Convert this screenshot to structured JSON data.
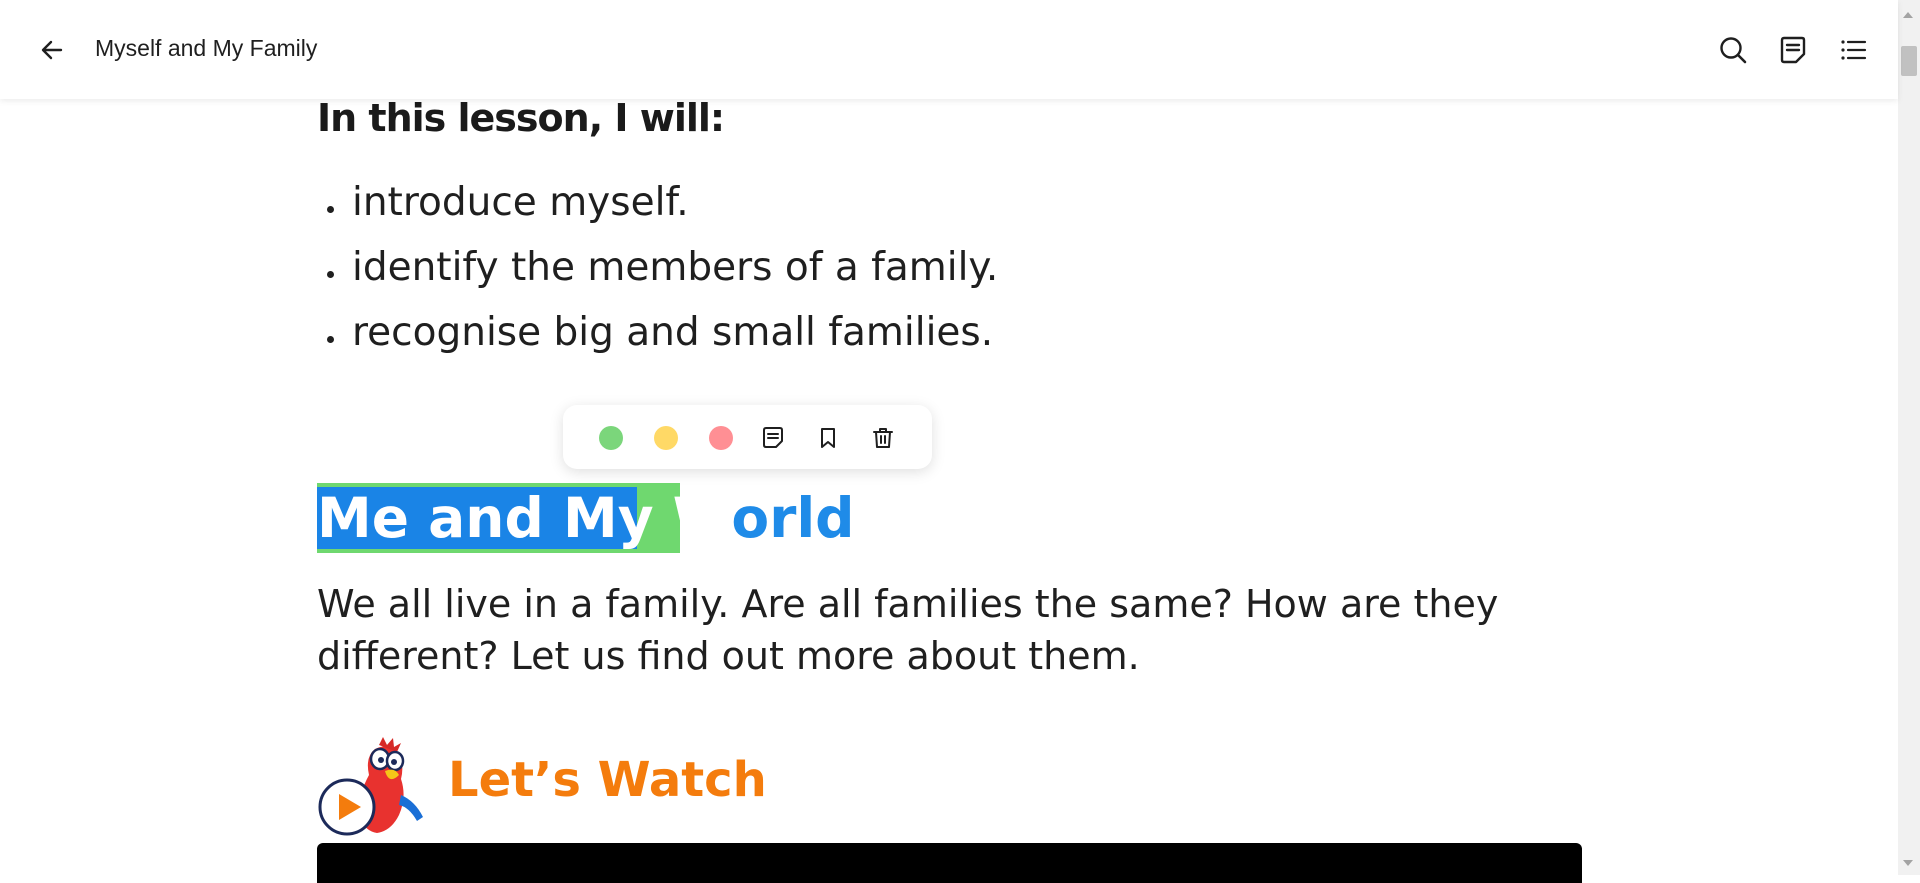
{
  "header": {
    "title": "Myself and My Family",
    "icons": [
      "back-arrow-icon",
      "search-icon",
      "notes-icon",
      "table-of-contents-icon"
    ]
  },
  "lesson": {
    "heading": "In this lesson, I will:",
    "bullets": [
      "introduce myself.",
      "identify the members of a family.",
      "recognise big and small families."
    ]
  },
  "highlight_toolbar": {
    "swatches": [
      {
        "name": "green",
        "color": "#7bd67b"
      },
      {
        "name": "yellow",
        "color": "#ffd966"
      },
      {
        "name": "red",
        "color": "#ff8f94"
      }
    ],
    "icons": [
      "add-note-icon",
      "bookmark-icon",
      "delete-icon"
    ]
  },
  "section": {
    "title_selected": "Me and My W",
    "title_rest": "orld",
    "paragraph": "We all live in a family. Are all families the same? How are they different? Let us find out more about them."
  },
  "watch": {
    "label": "Let’s Watch",
    "mascot_icon": "parrot-mascot-play-icon"
  },
  "colors": {
    "accent_blue": "#1f8be8",
    "selection_blue": "#1a84e6",
    "highlight_green": "#6fd86f",
    "watch_orange": "#f47c0d"
  }
}
